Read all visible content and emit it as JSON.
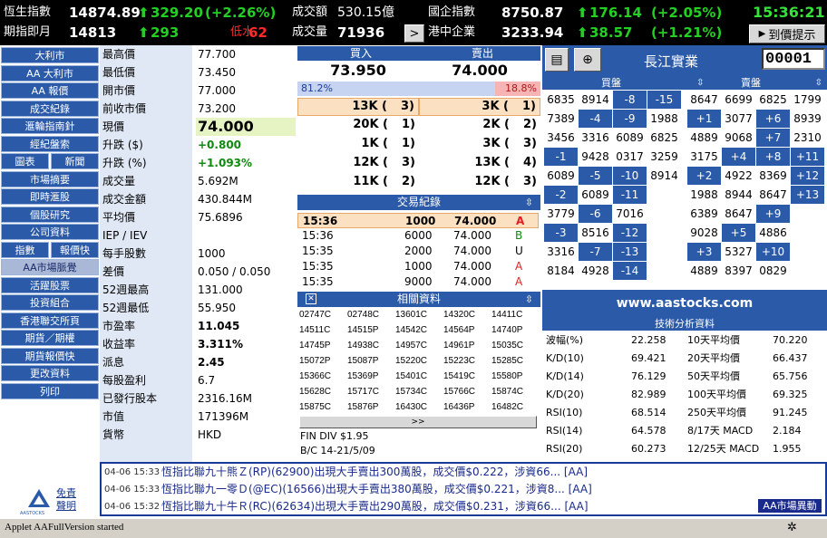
{
  "ticker": {
    "hsi_label": "恆生指數",
    "hsi_value": "14874.89",
    "hsi_change": "329.20",
    "hsi_pct": "(+2.26%)",
    "turnover_label": "成交額",
    "turnover_value": "530.15億",
    "nat_label": "國企指數",
    "nat_value": "8750.87",
    "nat_change": "176.14",
    "nat_pct": "(+2.05%)",
    "time": "15:36:21",
    "fut_label": "期指即月",
    "fut_value": "14813",
    "fut_change": "293",
    "fut_status": "低水",
    "fut_diff": "62",
    "volume_label": "成交量",
    "volume_value": "71936",
    "hkce_label": "港中企業",
    "hkce_value": "3233.94",
    "hkce_change": "38.57",
    "hkce_pct": "(+1.21%)",
    "alert_label": "到價提示",
    "next_label": ">"
  },
  "nav": {
    "items": [
      "大利市",
      "AA 大利市",
      "AA 報價",
      "成交紀錄",
      "滙輪指南針",
      "經紀盤索",
      "圖表",
      "新聞",
      "市場摘要",
      "即時滙股",
      "個股研究",
      "公司資料",
      "指數",
      "報價快",
      "AA市場脈覺",
      "活躍股票",
      "投資組合",
      "香港聯交所頁",
      "期貨／期權",
      "期貨報價快",
      "更改資料",
      "列印"
    ],
    "disclaimer": "免責聲明",
    "logo_text": "AASTOCKS"
  },
  "quote": {
    "rows": [
      {
        "k": "最高價",
        "v": "77.700"
      },
      {
        "k": "最低價",
        "v": "73.450"
      },
      {
        "k": "開市價",
        "v": "77.000"
      },
      {
        "k": "前收市價",
        "v": "73.200"
      },
      {
        "k": "現價",
        "v": "74.000"
      },
      {
        "k": "升跌 ($)",
        "v": "+0.800"
      },
      {
        "k": "升跌 (%)",
        "v": "+1.093%"
      },
      {
        "k": "成交量",
        "v": "5.692M"
      },
      {
        "k": "成交金額",
        "v": "430.844M"
      },
      {
        "k": "平均價",
        "v": "75.6896"
      },
      {
        "k": "IEP / IEV",
        "v": ""
      },
      {
        "k": "每手股數",
        "v": "1000"
      },
      {
        "k": "差價",
        "v": "0.050 / 0.050"
      },
      {
        "k": "52週最高",
        "v": "131.000"
      },
      {
        "k": "52週最低",
        "v": "55.950"
      },
      {
        "k": "市盈率",
        "v": "11.045"
      },
      {
        "k": "收益率",
        "v": "3.311%"
      },
      {
        "k": "派息",
        "v": "2.45"
      },
      {
        "k": "每股盈利",
        "v": "6.7"
      },
      {
        "k": "已發行股本",
        "v": "2316.16M"
      },
      {
        "k": "市值",
        "v": "171396M"
      },
      {
        "k": "貨幣",
        "v": "HKD"
      }
    ]
  },
  "orderbook": {
    "bid_label": "買入",
    "ask_label": "賣出",
    "bid_price": "73.950",
    "ask_price": "74.000",
    "bid_pct": "81.2%",
    "ask_pct": "18.8%",
    "bid_share": 0.812,
    "rows": [
      {
        "bq": "13K (",
        "bn": "3)",
        "aq": "3K (",
        "an": "1)"
      },
      {
        "bq": "20K (",
        "bn": "1)",
        "aq": "2K (",
        "an": "2)"
      },
      {
        "bq": "1K (",
        "bn": "1)",
        "aq": "3K (",
        "an": "3)"
      },
      {
        "bq": "12K (",
        "bn": "3)",
        "aq": "13K (",
        "an": "4)"
      },
      {
        "bq": "11K (",
        "bn": "2)",
        "aq": "12K (",
        "an": "3)"
      }
    ]
  },
  "trades": {
    "title": "交易紀錄",
    "rows": [
      {
        "t": "15:36",
        "q": "1000",
        "p": "74.000",
        "s": "A"
      },
      {
        "t": "15:36",
        "q": "6000",
        "p": "74.000",
        "s": "B"
      },
      {
        "t": "15:35",
        "q": "2000",
        "p": "74.000",
        "s": "U"
      },
      {
        "t": "15:35",
        "q": "1000",
        "p": "74.000",
        "s": "A"
      },
      {
        "t": "15:35",
        "q": "9000",
        "p": "74.000",
        "s": "A"
      }
    ]
  },
  "related": {
    "title": "相關資料",
    "codes": [
      [
        "02747C",
        "02748C",
        "13601C",
        "14320C",
        "14411C"
      ],
      [
        "14511C",
        "14515P",
        "14542C",
        "14564P",
        "14740P"
      ],
      [
        "14745P",
        "14938C",
        "14957C",
        "14961P",
        "15035C"
      ],
      [
        "15072P",
        "15087P",
        "15220C",
        "15223C",
        "15285C"
      ],
      [
        "15366C",
        "15369P",
        "15401C",
        "15419C",
        "15580P"
      ],
      [
        "15628C",
        "15717C",
        "15734C",
        "15766C",
        "15874C"
      ],
      [
        "15875C",
        "15876P",
        "16430C",
        "16436P",
        "16482C"
      ]
    ],
    "more_label": ">>",
    "div_line": "FIN DIV $1.95",
    "bc_line": "B/C 14-21/5/09"
  },
  "stock": {
    "name": "長江實業",
    "code": "00001"
  },
  "queue": {
    "bid_label": "買盤",
    "ask_label": "賣盤",
    "bid": [
      [
        {
          "v": "6835",
          "b": false
        },
        {
          "v": "8914",
          "b": false
        },
        {
          "v": "-8",
          "b": true
        },
        {
          "v": "-15",
          "b": true
        }
      ],
      [
        {
          "v": "7389",
          "b": false
        },
        {
          "v": "-4",
          "b": true
        },
        {
          "v": "-9",
          "b": true
        },
        {
          "v": "1988",
          "b": false
        }
      ],
      [
        {
          "v": "3456",
          "b": false
        },
        {
          "v": "3316",
          "b": false
        },
        {
          "v": "6089",
          "b": false
        },
        {
          "v": "6825",
          "b": false
        }
      ],
      [
        {
          "v": "-1",
          "b": true
        },
        {
          "v": "9428",
          "b": false
        },
        {
          "v": "0317",
          "b": false
        },
        {
          "v": "3259",
          "b": false
        }
      ],
      [
        {
          "v": "6089",
          "b": false
        },
        {
          "v": "-5",
          "b": true
        },
        {
          "v": "-10",
          "b": true
        },
        {
          "v": "8914",
          "b": false
        }
      ],
      [
        {
          "v": "-2",
          "b": true
        },
        {
          "v": "6089",
          "b": false
        },
        {
          "v": "-11",
          "b": true
        },
        {
          "v": "",
          "b": false
        }
      ],
      [
        {
          "v": "3779",
          "b": false
        },
        {
          "v": "-6",
          "b": true
        },
        {
          "v": "7016",
          "b": false
        },
        {
          "v": "",
          "b": false
        }
      ],
      [
        {
          "v": "-3",
          "b": true
        },
        {
          "v": "8516",
          "b": false
        },
        {
          "v": "-12",
          "b": true
        },
        {
          "v": "",
          "b": false
        }
      ],
      [
        {
          "v": "3316",
          "b": false
        },
        {
          "v": "-7",
          "b": true
        },
        {
          "v": "-13",
          "b": true
        },
        {
          "v": "",
          "b": false
        }
      ],
      [
        {
          "v": "8184",
          "b": false
        },
        {
          "v": "4928",
          "b": false
        },
        {
          "v": "-14",
          "b": true
        },
        {
          "v": "",
          "b": false
        }
      ]
    ],
    "ask": [
      [
        {
          "v": "8647",
          "b": false
        },
        {
          "v": "6699",
          "b": false
        },
        {
          "v": "6825",
          "b": false
        },
        {
          "v": "1799",
          "b": false
        }
      ],
      [
        {
          "v": "+1",
          "b": true
        },
        {
          "v": "3077",
          "b": false
        },
        {
          "v": "+6",
          "b": true
        },
        {
          "v": "8939",
          "b": false
        }
      ],
      [
        {
          "v": "4889",
          "b": false
        },
        {
          "v": "9068",
          "b": false
        },
        {
          "v": "+7",
          "b": true
        },
        {
          "v": "2310",
          "b": false
        }
      ],
      [
        {
          "v": "3175",
          "b": false
        },
        {
          "v": "+4",
          "b": true
        },
        {
          "v": "+8",
          "b": true
        },
        {
          "v": "+11",
          "b": true
        }
      ],
      [
        {
          "v": "+2",
          "b": true
        },
        {
          "v": "4922",
          "b": false
        },
        {
          "v": "8369",
          "b": false
        },
        {
          "v": "+12",
          "b": true
        }
      ],
      [
        {
          "v": "1988",
          "b": false
        },
        {
          "v": "8944",
          "b": false
        },
        {
          "v": "8647",
          "b": false
        },
        {
          "v": "+13",
          "b": true
        }
      ],
      [
        {
          "v": "6389",
          "b": false
        },
        {
          "v": "8647",
          "b": false
        },
        {
          "v": "+9",
          "b": true
        },
        {
          "v": "",
          "b": false
        }
      ],
      [
        {
          "v": "9028",
          "b": false
        },
        {
          "v": "+5",
          "b": true
        },
        {
          "v": "4886",
          "b": false
        },
        {
          "v": "",
          "b": false
        }
      ],
      [
        {
          "v": "+3",
          "b": true
        },
        {
          "v": "5327",
          "b": false
        },
        {
          "v": "+10",
          "b": true
        },
        {
          "v": "",
          "b": false
        }
      ],
      [
        {
          "v": "4889",
          "b": false
        },
        {
          "v": "8397",
          "b": false
        },
        {
          "v": "0829",
          "b": false
        },
        {
          "v": "",
          "b": false
        }
      ]
    ]
  },
  "site_url": "www.aastocks.com",
  "tech": {
    "title": "技術分析資料",
    "rows": [
      {
        "k1": "波幅(%)",
        "v1": "22.258",
        "k2": "10天平均價",
        "v2": "70.220"
      },
      {
        "k1": "K/D(10)",
        "v1": "69.421",
        "k2": "20天平均價",
        "v2": "66.437"
      },
      {
        "k1": "K/D(14)",
        "v1": "76.129",
        "k2": "50天平均價",
        "v2": "65.756"
      },
      {
        "k1": "K/D(20)",
        "v1": "82.989",
        "k2": "100天平均價",
        "v2": "69.325"
      },
      {
        "k1": "RSI(10)",
        "v1": "68.514",
        "k2": "250天平均價",
        "v2": "91.245"
      },
      {
        "k1": "RSI(14)",
        "v1": "64.578",
        "k2": "8/17天 MACD",
        "v2": "2.184"
      },
      {
        "k1": "RSI(20)",
        "v1": "60.273",
        "k2": "12/25天 MACD",
        "v2": "1.955"
      }
    ]
  },
  "news": {
    "items": [
      {
        "d": "04-06 15:33",
        "t": "恆指比聯九十熊Ｚ(RP)(62900)出現大手賣出300萬股，成交價$0.222，涉資66... [AA]"
      },
      {
        "d": "04-06 15:33",
        "t": "恆指比聯九一零Ｄ(@EC)(16566)出現大手賣出380萬股，成交價$0.221，涉資8... [AA]"
      },
      {
        "d": "04-06 15:32",
        "t": "恆指比聯九十牛Ｒ(RC)(62634)出現大手賣出290萬股，成交價$0.231，涉資66... [AA]"
      }
    ],
    "badge": "AA市場異動"
  },
  "status": {
    "text": "Applet AAFullVersion started"
  }
}
